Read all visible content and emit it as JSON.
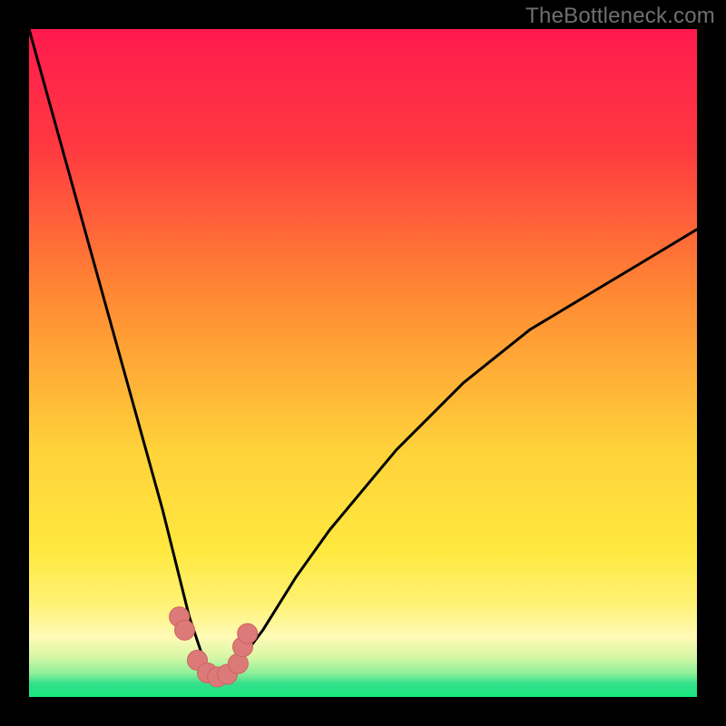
{
  "watermark": "TheBottleneck.com",
  "colors": {
    "gradient_top": "#ff1a4e",
    "gradient_orange": "#ff8a33",
    "gradient_yellow": "#ffe83f",
    "gradient_paleyellow": "#fff9b8",
    "gradient_green": "#17e67e",
    "curve": "#000000",
    "marker_fill": "#db7a78",
    "marker_stroke": "#cf6361"
  },
  "chart_data": {
    "type": "line",
    "title": "",
    "xlabel": "",
    "ylabel": "",
    "xlim": [
      0,
      100
    ],
    "ylim": [
      0,
      100
    ],
    "series": [
      {
        "name": "bottleneck-curve",
        "x": [
          0,
          5,
          10,
          15,
          20,
          22,
          24,
          26,
          27,
          28,
          29,
          30,
          32,
          35,
          40,
          45,
          50,
          55,
          60,
          65,
          70,
          75,
          80,
          85,
          90,
          95,
          100
        ],
        "y": [
          100,
          82,
          64,
          46,
          28,
          20,
          12,
          6,
          4,
          3,
          3,
          4,
          6,
          10,
          18,
          25,
          31,
          37,
          42,
          47,
          51,
          55,
          58,
          61,
          64,
          67,
          70
        ]
      }
    ],
    "markers": {
      "name": "highlight-points",
      "x": [
        22.5,
        23.3,
        25.2,
        26.7,
        28.2,
        29.7,
        31.3,
        32.0,
        32.7
      ],
      "y": [
        12.0,
        10.0,
        5.5,
        3.6,
        3.0,
        3.4,
        5.0,
        7.5,
        9.5
      ]
    }
  }
}
